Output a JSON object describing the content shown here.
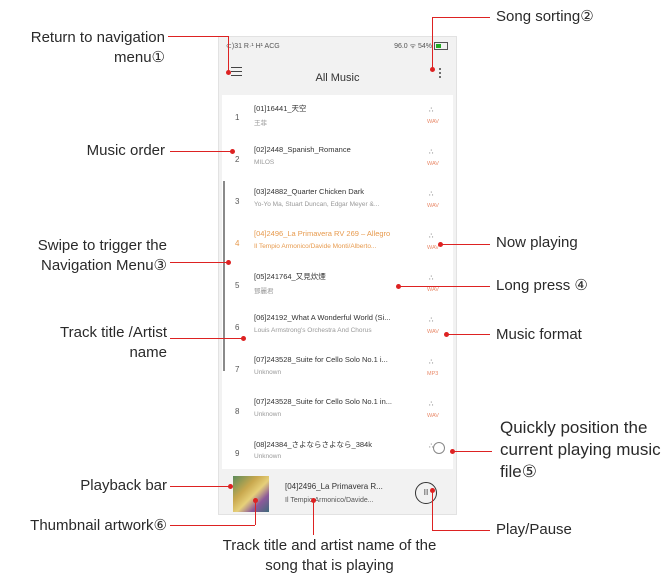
{
  "status": {
    "left": "⊂)31 R·¹ H¹ ACG",
    "right": "96.0 ᯤ 54%"
  },
  "header": {
    "title": "All Music",
    "menu_icon": "hamburger-icon",
    "sort_icon": "kebab-icon"
  },
  "tracks": [
    {
      "num": "1",
      "title": "[01]16441_天空",
      "artist": "王菲",
      "format": "WAV"
    },
    {
      "num": "2",
      "title": "[02]2448_Spanish_Romance",
      "artist": "MILOS",
      "format": "WAV"
    },
    {
      "num": "3",
      "title": "[03]24882_Quarter Chicken Dark",
      "artist": "Yo-Yo Ma, Stuart Duncan, Edgar Meyer &...",
      "format": "WAV"
    },
    {
      "num": "4",
      "title": "[04]2496_La Primavera RV 269 – Allegro",
      "artist": "Il Tempio Armonico/Davide Monti/Alberto...",
      "format": "WAV"
    },
    {
      "num": "5",
      "title": "[05]241764_又見炊煙",
      "artist": "鄧麗君",
      "format": "WAV"
    },
    {
      "num": "6",
      "title": "[06]24192_What A Wonderful World (Si...",
      "artist": "Louis Armstrong's Orchestra And Chorus",
      "format": "WAV"
    },
    {
      "num": "7",
      "title": "[07]243528_Suite for Cello Solo No.1 i...",
      "artist": "Unknown",
      "format": "MP3"
    },
    {
      "num": "8",
      "title": "[07]243528_Suite for Cello Solo No.1 in...",
      "artist": "Unknown",
      "format": "WAV"
    },
    {
      "num": "9",
      "title": "[08]24384_さよならさよなら_384k",
      "artist": "Unknown",
      "format": "WAV"
    }
  ],
  "playbar": {
    "title": "[04]2496_La Primavera R...",
    "artist": "Il Tempio Armonico/Davide...",
    "button": "II"
  },
  "callouts": {
    "return_nav": "Return to navigation menu①",
    "song_sorting": "Song sorting②",
    "music_order": "Music order",
    "swipe": "Swipe to trigger the Navigation Menu③",
    "track_title": "Track title /Artist name",
    "now_playing": "Now playing",
    "long_press": "Long press ④",
    "music_format": "Music format",
    "quick_position": "Quickly position the current playing music file⑤",
    "playback_bar": "Playback bar",
    "thumbnail": "Thumbnail artwork⑥",
    "play_pause": "Play/Pause",
    "bottom_caption": "Track title and artist name of the song that is playing"
  },
  "colors": {
    "annotation": "#dd2222",
    "playing": "#e79a4d",
    "format": "#e98a6a"
  }
}
